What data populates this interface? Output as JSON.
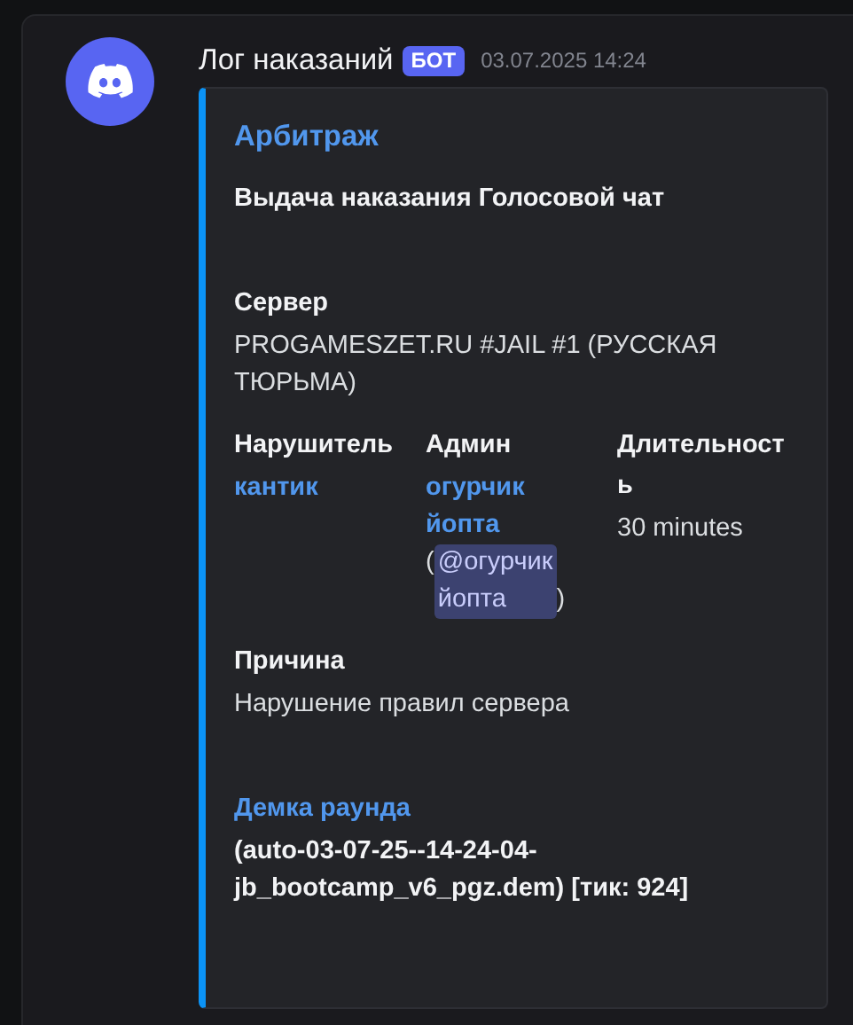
{
  "message": {
    "author": "Лог наказаний",
    "badge": "БОТ",
    "timestamp": "03.07.2025 14:24",
    "embed": {
      "title": "Арбитраж",
      "description": "Выдача наказания Голосовой чат",
      "blocks": [
        {
          "kind": "field",
          "name": "Сервер",
          "values": [
            {
              "kind": "plain",
              "text": "PROGAMESZET.RU #JAIL #1 (РУССКАЯ ТЮРЬМА)"
            }
          ]
        },
        {
          "kind": "inline_row",
          "fields": [
            {
              "name": "Нарушитель",
              "values": [
                {
                  "kind": "link",
                  "text": "кантик"
                }
              ]
            },
            {
              "name": "Админ",
              "values": [
                {
                  "kind": "link",
                  "text": "огурчик йопта"
                },
                {
                  "kind": "plain",
                  "text": "("
                },
                {
                  "kind": "mention",
                  "text": "@огурчик йопта"
                },
                {
                  "kind": "plain",
                  "text": ")"
                }
              ]
            },
            {
              "name": "Длительность",
              "values": [
                {
                  "kind": "plain",
                  "text": "30 minutes"
                }
              ]
            }
          ]
        },
        {
          "kind": "field",
          "name": "Причина",
          "values": [
            {
              "kind": "plain",
              "text": "Нарушение правил сервера"
            }
          ]
        },
        {
          "kind": "link_section",
          "name": "Демка раунда",
          "values": [
            {
              "kind": "bold",
              "text": "(auto-03-07-25--14-24-04-jb_bootcamp_v6_pgz.dem) [тик: 924]"
            }
          ]
        }
      ]
    }
  }
}
